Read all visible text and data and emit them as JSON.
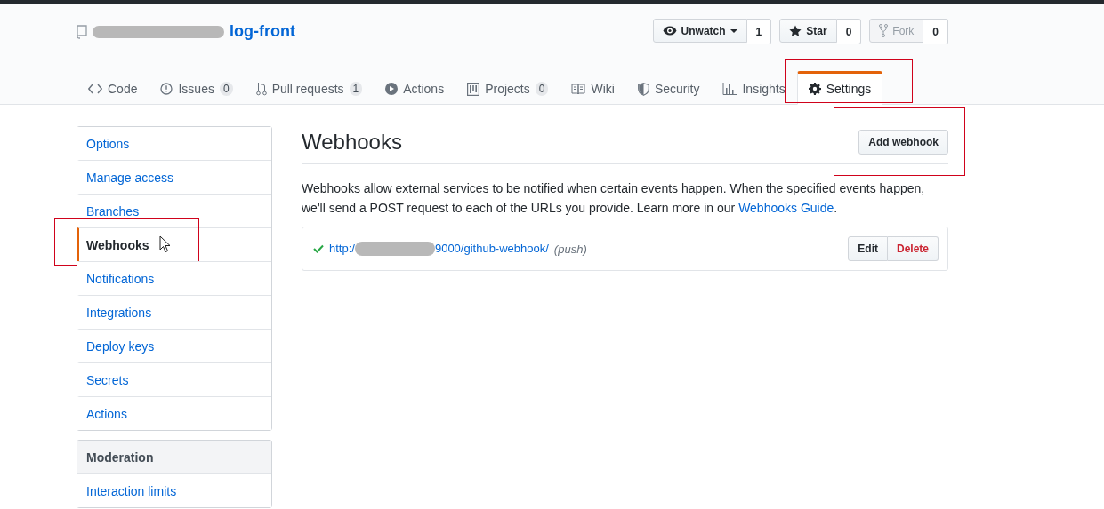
{
  "repo": {
    "name": "log-front"
  },
  "actions": [
    {
      "kind": "watch",
      "label": "Unwatch",
      "count": "1",
      "disabled": false
    },
    {
      "kind": "star",
      "label": "Star",
      "count": "0",
      "disabled": false
    },
    {
      "kind": "fork",
      "label": "Fork",
      "count": "0",
      "disabled": true
    }
  ],
  "tabs": [
    {
      "kind": "code",
      "label": "Code",
      "selected": false,
      "highlighted": false
    },
    {
      "kind": "issues",
      "label": "Issues",
      "count": "0",
      "selected": false,
      "highlighted": false
    },
    {
      "kind": "pulls",
      "label": "Pull requests",
      "count": "1",
      "selected": false,
      "highlighted": false
    },
    {
      "kind": "actions",
      "label": "Actions",
      "selected": false,
      "highlighted": false
    },
    {
      "kind": "projects",
      "label": "Projects",
      "count": "0",
      "selected": false,
      "highlighted": false
    },
    {
      "kind": "wiki",
      "label": "Wiki",
      "selected": false,
      "highlighted": false
    },
    {
      "kind": "security",
      "label": "Security",
      "selected": false,
      "highlighted": false
    },
    {
      "kind": "insights",
      "label": "Insights",
      "selected": false,
      "highlighted": false
    },
    {
      "kind": "settings",
      "label": "Settings",
      "selected": true,
      "highlighted": true
    }
  ],
  "sidebar": {
    "items": [
      {
        "label": "Options",
        "selected": false,
        "highlighted": false
      },
      {
        "label": "Manage access",
        "selected": false,
        "highlighted": false
      },
      {
        "label": "Branches",
        "selected": false,
        "highlighted": false
      },
      {
        "label": "Webhooks",
        "selected": true,
        "highlighted": true
      },
      {
        "label": "Notifications",
        "selected": false,
        "highlighted": false
      },
      {
        "label": "Integrations",
        "selected": false,
        "highlighted": false
      },
      {
        "label": "Deploy keys",
        "selected": false,
        "highlighted": false
      },
      {
        "label": "Secrets",
        "selected": false,
        "highlighted": false
      },
      {
        "label": "Actions",
        "selected": false,
        "highlighted": false
      }
    ],
    "moderation": {
      "title": "Moderation",
      "items": [
        {
          "label": "Interaction limits",
          "selected": false,
          "highlighted": false
        }
      ]
    }
  },
  "main": {
    "title": "Webhooks",
    "add_button": {
      "label": "Add webhook",
      "highlighted": true
    },
    "description": "Webhooks allow external services to be notified when certain events happen. When the specified events happen, we'll send a POST request to each of the URLs you provide. Learn more in our ",
    "guide_link": "Webhooks Guide",
    "description_end": ".",
    "hooks": [
      {
        "active": true,
        "url_start": "http:/",
        "url_end": "9000/github-webhook/",
        "events": "(push)",
        "edit": "Edit",
        "delete": "Delete"
      }
    ]
  }
}
